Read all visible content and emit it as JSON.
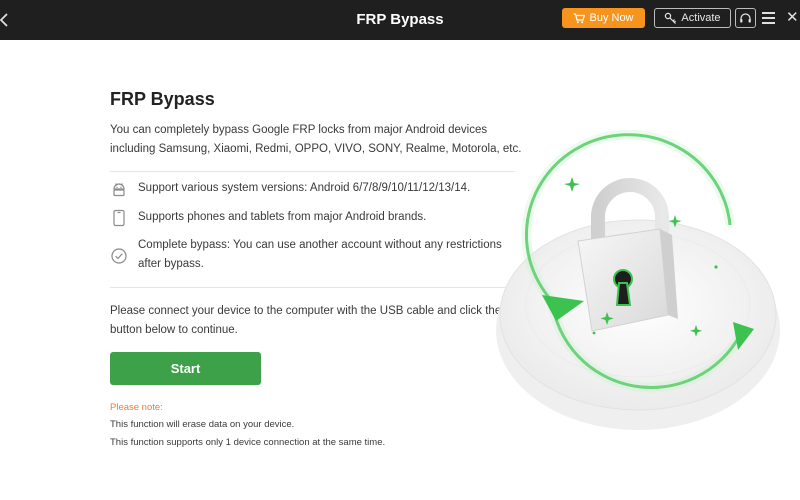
{
  "window": {
    "title": "FRP Bypass",
    "buy_now_label": "Buy Now",
    "activate_label": "Activate"
  },
  "main": {
    "heading": "FRP Bypass",
    "description": "You can completely bypass Google FRP locks from major Android devices including Samsung, Xiaomi, Redmi, OPPO, VIVO, SONY, Realme, Motorola, etc.",
    "features": [
      {
        "icon": "android-icon",
        "text": "Support various system versions: Android 6/7/8/9/10/11/12/13/14."
      },
      {
        "icon": "phone-icon",
        "text": "Supports phones and tablets from major Android brands."
      },
      {
        "icon": "check-circle-icon",
        "text": "Complete bypass: You can use another account without any restrictions after bypass."
      }
    ],
    "connect_text": "Please connect your device to the computer with the USB cable and click the button below to continue.",
    "start_label": "Start",
    "note_title": "Please note:",
    "notes": [
      "This function will erase data on your device.",
      "This function supports only 1 device connection at the same time."
    ]
  },
  "colors": {
    "titlebar": "#1f1f1f",
    "buy_now": "#f7941d",
    "start": "#3da14a",
    "note": "#f07a36",
    "illustration_green": "#3cc24f"
  }
}
